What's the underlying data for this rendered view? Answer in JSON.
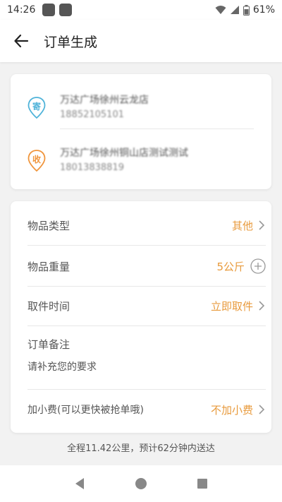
{
  "status_bar": {
    "time": "14:26",
    "battery": "61%"
  },
  "header": {
    "title": "订单生成",
    "back_icon": "arrow-left-icon"
  },
  "addresses": [
    {
      "tag": "寄",
      "tag_color": "#4fb3d9",
      "name": "万达广场徐州云龙店",
      "phone": "18852105101"
    },
    {
      "tag": "收",
      "tag_color": "#f0953c",
      "name": "万达广场徐州铜山店测试测试",
      "phone": "18013838819"
    }
  ],
  "form": {
    "item_type": {
      "label": "物品类型",
      "value": "其他"
    },
    "item_weight": {
      "label": "物品重量",
      "value": "5公斤"
    },
    "pickup_time": {
      "label": "取件时间",
      "value": "立即取件"
    },
    "remark": {
      "label": "订单备注",
      "placeholder": "请补充您的要求"
    },
    "tip": {
      "label": "加小费(可以更快被抢单哦)",
      "value": "不加小费"
    }
  },
  "summary": "全程11.42公里，预计62分钟内送达",
  "colors": {
    "accent": "#e89a3c",
    "send_pin": "#4fb3d9",
    "receive_pin": "#f0953c"
  }
}
